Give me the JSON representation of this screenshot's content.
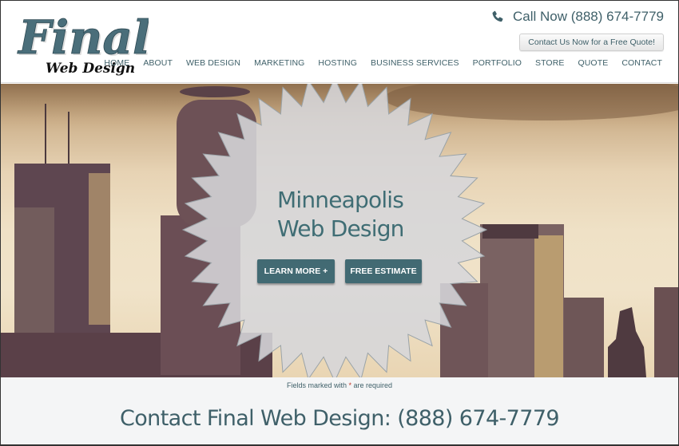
{
  "header": {
    "logo": {
      "line1": "Final",
      "line2": "Web Design"
    },
    "call_label": "Call Now (888) 674-7779",
    "phone_icon": "phone-icon",
    "quote_button": "Contact Us Now for a Free Quote!",
    "nav": [
      "HOME",
      "ABOUT",
      "WEB DESIGN",
      "MARKETING",
      "HOSTING",
      "BUSINESS SERVICES",
      "PORTFOLIO",
      "STORE",
      "QUOTE",
      "CONTACT"
    ]
  },
  "hero": {
    "title_line1": "Minneapolis",
    "title_line2": "Web Design",
    "learn_more": "LEARN MORE +",
    "free_estimate": "FREE ESTIMATE",
    "background": "Minneapolis skyline at sunset (sepia)"
  },
  "contact": {
    "fields_note_before": "Fields marked with ",
    "required_mark": "*",
    "fields_note_after": " are required",
    "title": "Contact Final Web Design: (888) 674-7779"
  },
  "colors": {
    "brand": "#426a73",
    "text": "#3f6069",
    "required": "#c0392b"
  }
}
